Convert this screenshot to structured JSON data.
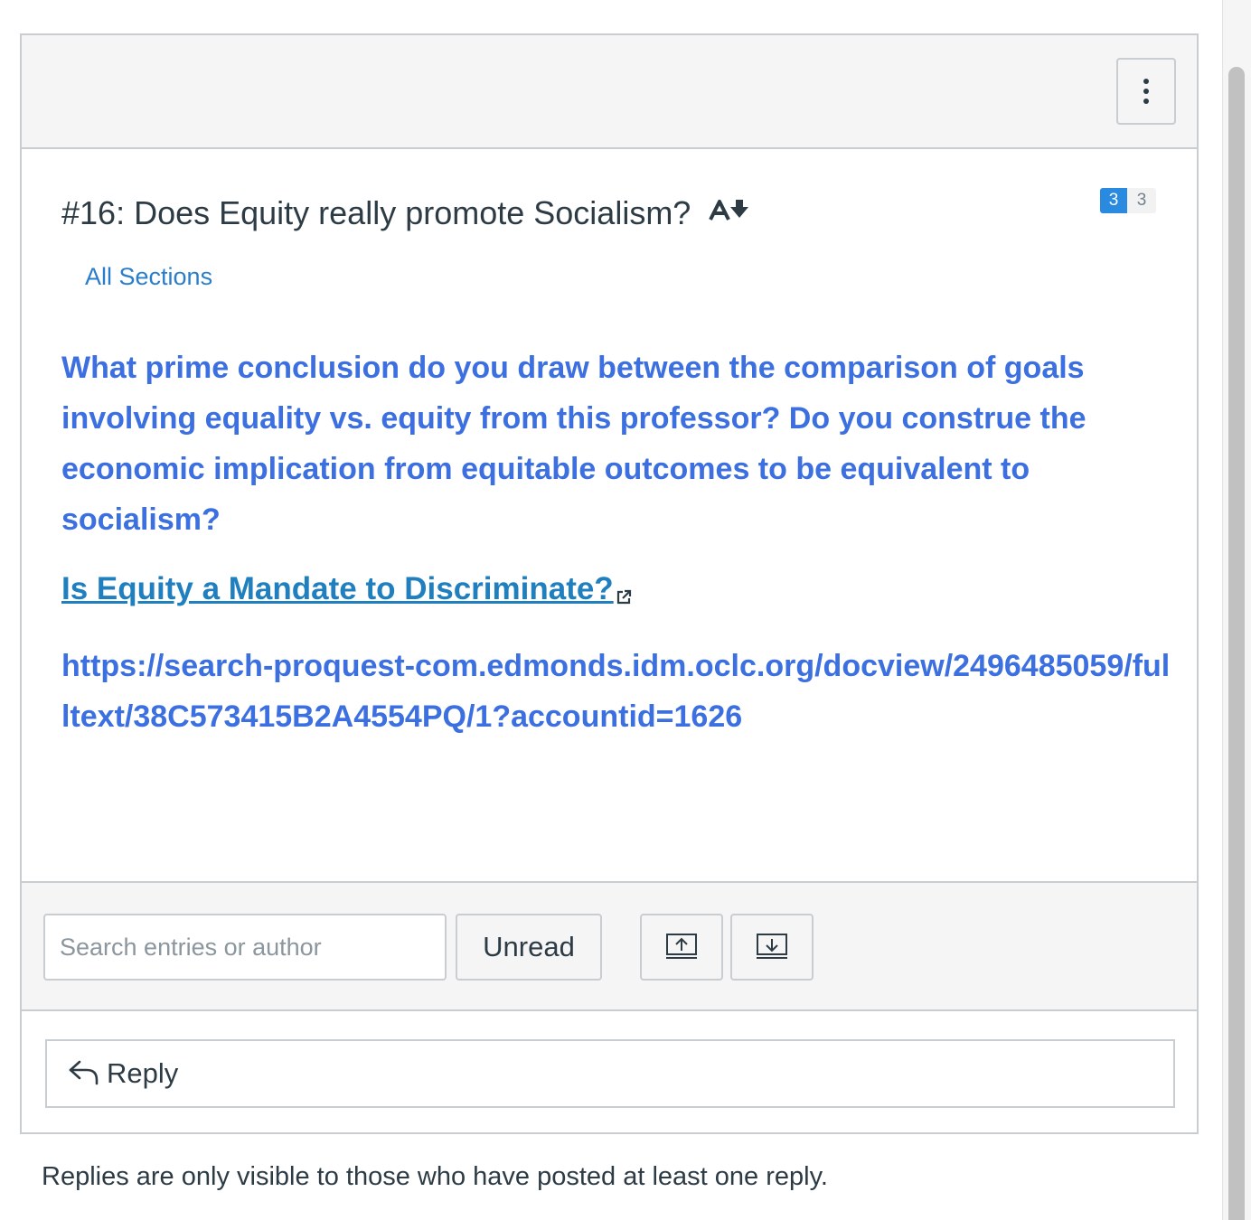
{
  "topic": {
    "title": "#16: Does Equity really promote Socialism?",
    "sections_label": "All Sections",
    "unread_count": "3",
    "total_count": "3",
    "body": "What prime conclusion do you draw between the comparison of goals involving equality vs. equity from this professor?  Do you construe the economic implication from equitable outcomes to be equivalent to socialism?",
    "link_text": "Is Equity a Mandate to Discriminate?",
    "url_text": "https://search-proquest-com.edmonds.idm.oclc.org/docview/2496485059/fulltext/38C573415B2A4554PQ/1?accountid=1626"
  },
  "toolbar": {
    "search_placeholder": "Search entries or author",
    "unread_label": "Unread"
  },
  "reply": {
    "label": "Reply"
  },
  "notice": "Replies are only visible to those who have posted at least one reply.",
  "icons": {
    "menu": "vertical-ellipsis-icon",
    "title": "text-size-icon",
    "external": "external-link-icon",
    "collapse": "collapse-threads-icon",
    "expand": "expand-threads-icon",
    "reply": "reply-arrow-icon"
  },
  "colors": {
    "body_text": "#3c6fe0",
    "link": "#1f7fbf",
    "badge_unread": "#2a8ae0",
    "border": "#c7cdd1"
  }
}
